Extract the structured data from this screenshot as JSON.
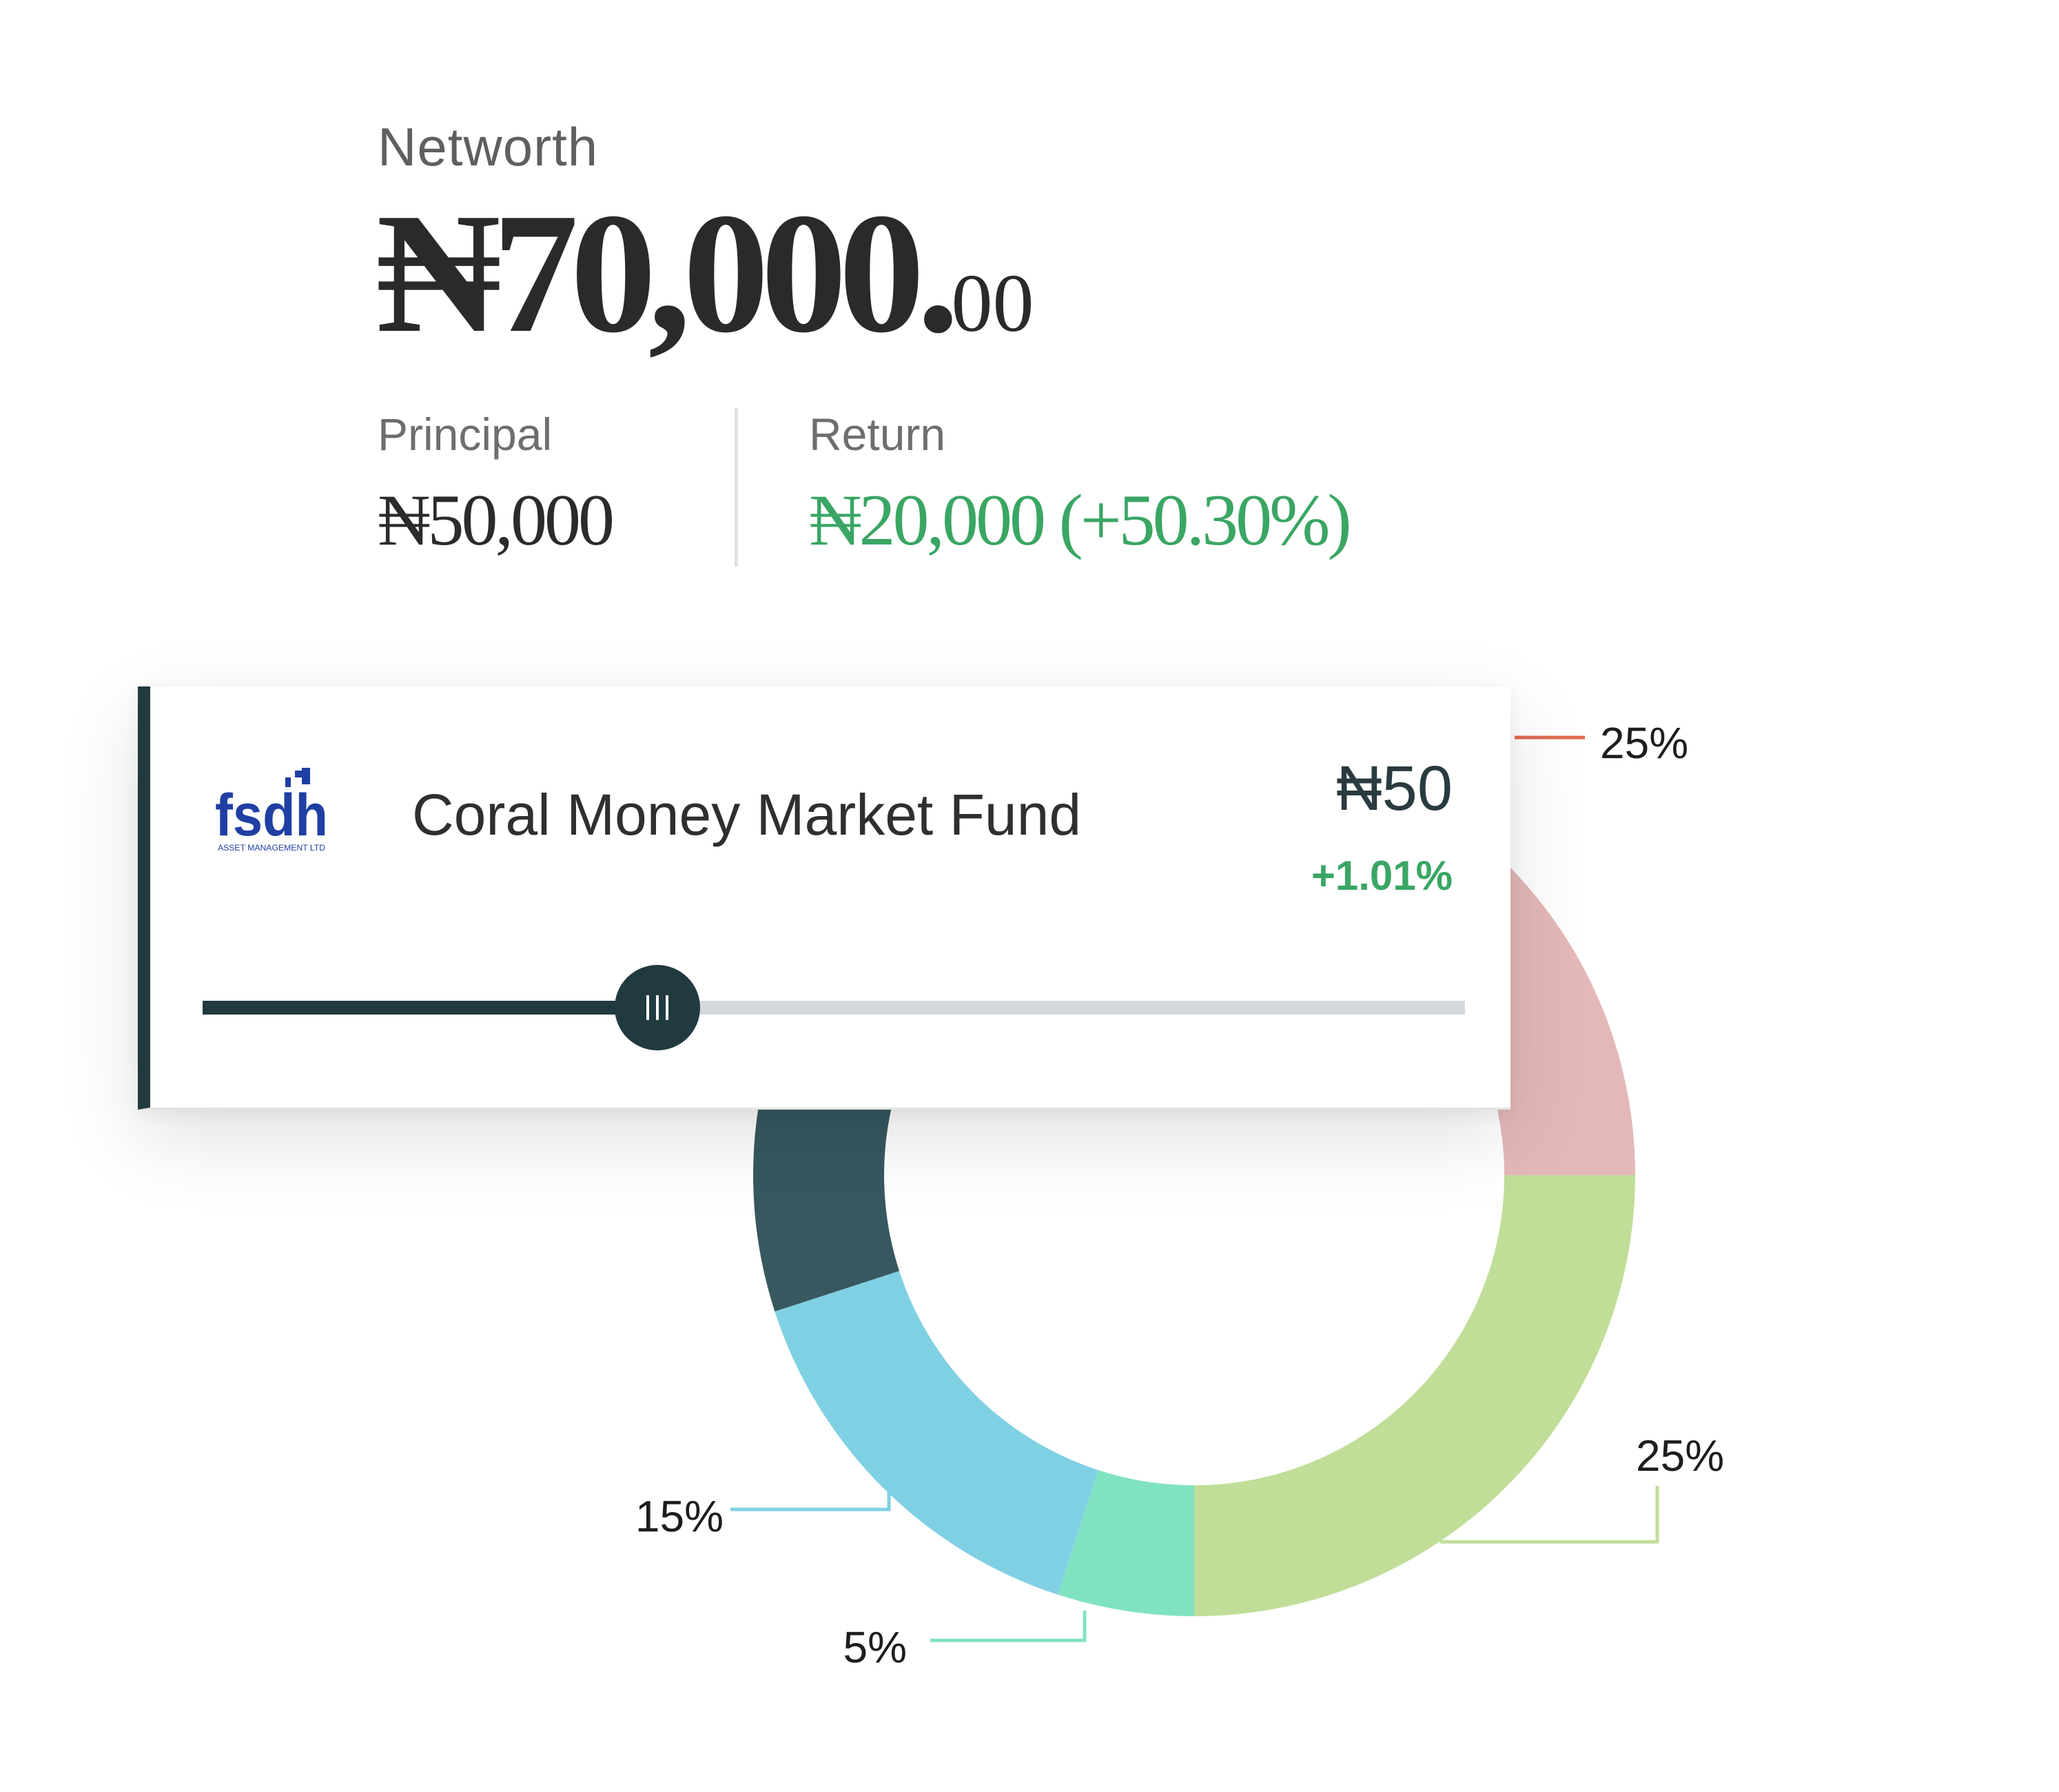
{
  "networth": {
    "label": "Networth",
    "value_main": "₦70,000.",
    "value_decimals": "00"
  },
  "principal": {
    "label": "Principal",
    "value": "₦50,000"
  },
  "return": {
    "label": "Return",
    "value": "₦20,000 (+50.30%)"
  },
  "fund_card": {
    "logo_text": "fsdh",
    "logo_subtext": "ASSET MANAGEMENT LTD",
    "name": "Coral Money Market Fund",
    "amount": "₦50",
    "change": "+1.01%",
    "slider_fraction": 0.36
  },
  "colors": {
    "text_dark": "#2a2a2a",
    "positive_green": "#3aa664",
    "card_accent": "#213a40",
    "logo_blue": "#1f3fa3"
  },
  "chart_data": {
    "type": "pie",
    "variant": "donut",
    "slices": [
      {
        "label": "25%",
        "value": 25,
        "color": "#e5b8b8",
        "leader_color": "#e0694f"
      },
      {
        "label": "25%",
        "value": 25,
        "color": "#c0de98",
        "leader_color": "#c0de98"
      },
      {
        "label": "5%",
        "value": 5,
        "color": "#80e3c0",
        "leader_color": "#80e3c0"
      },
      {
        "label": "15%",
        "value": 15,
        "color": "#80d0e4",
        "leader_color": "#80d0e4"
      },
      {
        "label": "",
        "value": 30,
        "color": "#37585f",
        "leader_color": ""
      }
    ],
    "legend": "none"
  }
}
